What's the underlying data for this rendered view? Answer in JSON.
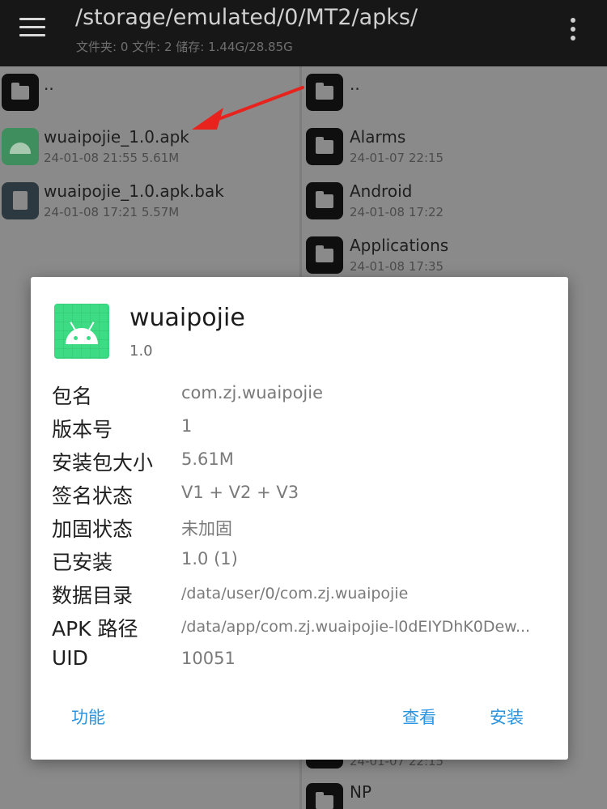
{
  "header": {
    "path": "/storage/emulated/0/MT2/apks/",
    "summary": "文件夹: 0  文件: 2  储存: 1.44G/28.85G"
  },
  "left_pane": {
    "items": [
      {
        "name": "..",
        "meta": "",
        "icon": "folder-icon"
      },
      {
        "name": "wuaipojie_1.0.apk",
        "meta": "24-01-08 21:55  5.61M",
        "icon": "android-apk-icon"
      },
      {
        "name": "wuaipojie_1.0.apk.bak",
        "meta": "24-01-08 17:21  5.57M",
        "icon": "file-icon"
      }
    ]
  },
  "right_pane": {
    "items": [
      {
        "name": "..",
        "meta": "",
        "icon": "folder-icon"
      },
      {
        "name": "Alarms",
        "meta": "24-01-07 22:15",
        "icon": "folder-icon"
      },
      {
        "name": "Android",
        "meta": "24-01-08 17:22",
        "icon": "folder-icon"
      },
      {
        "name": "Applications",
        "meta": "24-01-08 17:35",
        "icon": "folder-icon"
      },
      {
        "name": "",
        "meta": "24-01-07 22:15",
        "icon": "folder-icon"
      },
      {
        "name": "NP",
        "meta": "",
        "icon": "folder-icon"
      }
    ]
  },
  "dialog": {
    "app_name": "wuaipojie",
    "app_version": "1.0",
    "rows": [
      {
        "label": "包名",
        "value": "com.zj.wuaipojie"
      },
      {
        "label": "版本号",
        "value": "1"
      },
      {
        "label": "安装包大小",
        "value": "5.61M"
      },
      {
        "label": "签名状态",
        "value": "V1 + V2 + V3"
      },
      {
        "label": "加固状态",
        "value": "未加固"
      },
      {
        "label": "已安装",
        "value": "1.0 (1)"
      },
      {
        "label": "数据目录",
        "value": "/data/user/0/com.zj.wuaipojie"
      },
      {
        "label": "APK 路径",
        "value": "/data/app/com.zj.wuaipojie-l0dEIYDhK0Dew..."
      },
      {
        "label": "UID",
        "value": "10051"
      }
    ],
    "buttons": {
      "functions": "功能",
      "view": "查看",
      "install": "安装"
    }
  },
  "colors": {
    "accent": "#2b95e0",
    "annotation_arrow": "#e8231e",
    "android_green": "#3ddc84"
  }
}
